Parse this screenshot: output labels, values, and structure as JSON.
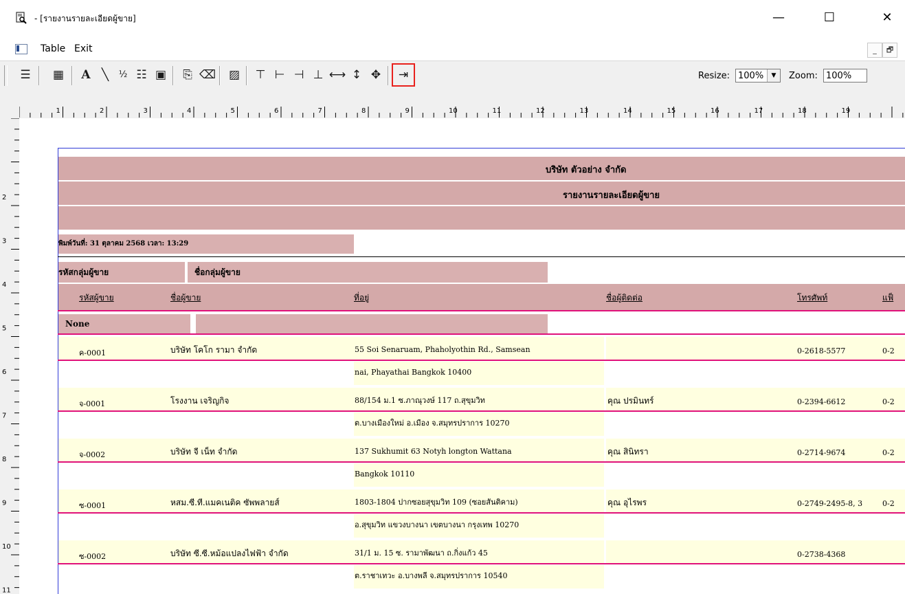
{
  "window": {
    "title": "- [รายงานรายละเอียดผู้ขาย]",
    "minimize": "—",
    "maximize": "☐",
    "close": "✕"
  },
  "menu": {
    "items": [
      "Table",
      "Exit"
    ]
  },
  "mdi_controls": {
    "minimize": "_",
    "restore": "🗗"
  },
  "toolbar": {
    "resize_label": "Resize:",
    "resize_value": "100%",
    "zoom_label": "Zoom:",
    "zoom_value": "100%"
  },
  "ruler": {
    "h_numbers": [
      "1",
      "2",
      "3",
      "4",
      "5",
      "6",
      "7",
      "8",
      "9",
      "10",
      "11",
      "12",
      "13",
      "14",
      "15",
      "16",
      "17",
      "18",
      "19"
    ],
    "v_numbers": [
      "2",
      "3",
      "4",
      "5",
      "6",
      "7",
      "8",
      "9",
      "10",
      "11"
    ]
  },
  "report": {
    "company": "บริษัท ตัวอย่าง จำกัด",
    "report_title": "รายงานรายละเอียดผู้ขาย",
    "print_date": "พิมพ์วันที่: 31 ตุลาคม 2568  เวลา: 13:29",
    "group_headers": {
      "group_code": "รหัสกลุ่มผู้ขาย",
      "group_name": "ชื่อกลุ่มผู้ขาย"
    },
    "columns": {
      "vendor_code": "รหัสผู้ขาย",
      "vendor_name": "ชื่อผู้ขาย",
      "address": "ที่อยู่",
      "contact": "ชื่อผู้ติดต่อ",
      "phone": "โทรศัพท์",
      "fax": "แฟ็"
    },
    "group_value": "None",
    "rows": [
      {
        "code": "ค-0001",
        "name": "บริษัท โคโก รามา จำกัด",
        "addr1": "55 Soi Senaruam, Phaholyothin Rd.,  Samsean",
        "addr2": "nai, Phayathai Bangkok 10400",
        "contact": "",
        "phone": "0-2618-5577",
        "fax": "0-2"
      },
      {
        "code": "จ-0001",
        "name": "โรงงาน เจริญกิจ",
        "addr1": "88/154 ม.1 ซ.ภาณุวงษ์ 117 ถ.สุขุมวิท",
        "addr2": "ต.บางเมืองใหม่ อ.เมือง จ.สมุทรปราการ 10270",
        "contact": "คุณ ปรมินทร์",
        "phone": "0-2394-6612",
        "fax": "0-2"
      },
      {
        "code": "จ-0002",
        "name": "บริษัท จี เน็ท จำกัด",
        "addr1": "137 Sukhumit 63  Notyh longton Wattana",
        "addr2": "Bangkok 10110",
        "contact": "คุณ สินิทรา",
        "phone": "0-2714-9674",
        "fax": "0-2"
      },
      {
        "code": "ซ-0001",
        "name": "หสม.ซี.ที.แมคเนติค ซัพพลายส์",
        "addr1": "1803-1804  ปากซอยสุขุมวิท 109 (ซอยสันติคาม)",
        "addr2": "อ.สุขุมวิท แขวงบางนา เขตบางนา กรุงเทพ 10270",
        "contact": "คุณ อุไรพร",
        "phone": "0-2749-2495-8, 3",
        "fax": "0-2"
      },
      {
        "code": "ซ-0002",
        "name": "บริษัท ซี.ซี.หม้อแปลงไฟฟ้า จำกัด",
        "addr1": "31/1 ม. 15  ซ. รามาพัฒนา ถ.กิ่งแก้ว 45",
        "addr2": "ต.ราชาเทวะ อ.บางพลี จ.สมุทรปราการ 10540",
        "contact": "",
        "phone": "0-2738-4368",
        "fax": ""
      }
    ]
  }
}
